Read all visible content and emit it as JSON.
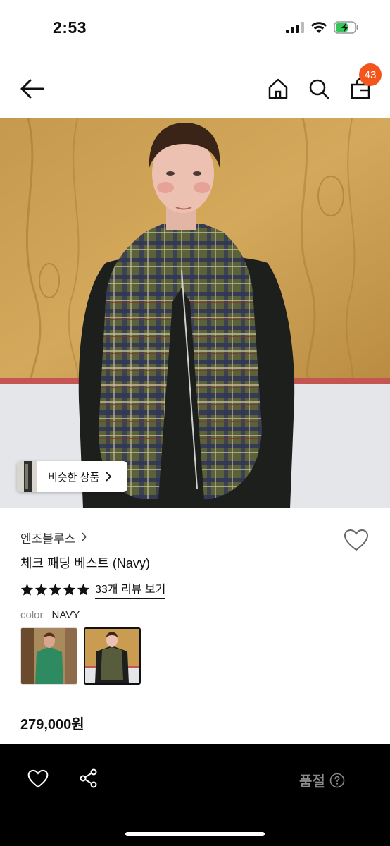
{
  "status_bar": {
    "time": "2:53"
  },
  "nav": {
    "cart_count": "43",
    "icons": [
      "back-arrow-icon",
      "home-icon",
      "search-icon",
      "shopping-bag-icon"
    ]
  },
  "hero": {
    "similar_label": "비슷한 상품"
  },
  "product": {
    "brand": "엔조블루스",
    "name": "체크 패딩 베스트 (Navy)",
    "rating_stars": 5,
    "reviews_label": "33개 리뷰 보기",
    "color_label": "color",
    "color_value": "NAVY",
    "price": "279,000원"
  },
  "bottom_bar": {
    "status_label": "품절"
  },
  "colors": {
    "badge": "#f2561d",
    "bottom_bar": "#000000",
    "soldout_text": "#8a8a8a"
  }
}
